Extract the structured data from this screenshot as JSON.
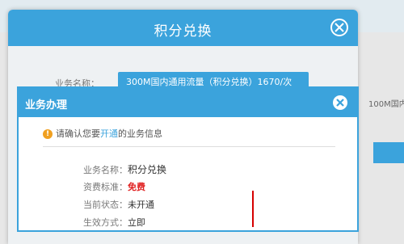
{
  "background": {
    "side_text": "100M国内"
  },
  "outer_dialog": {
    "title": "积分兑换",
    "field_label": "业务名称：",
    "field_value": "300M国内通用流量（积分兑换）1670/次"
  },
  "inner_dialog": {
    "title": "业务办理",
    "notice_prefix": "请确认您要",
    "notice_highlight": "开通",
    "notice_suffix": "的业务信息",
    "notice_icon": "!",
    "rows": [
      {
        "label": "业务名称：",
        "value": "积分兑换"
      },
      {
        "label": "资费标准：",
        "value": "免费"
      },
      {
        "label": "当前状态：",
        "value": "未开通"
      },
      {
        "label": "生效方式：",
        "value": "立即"
      }
    ]
  },
  "colors": {
    "accent": "#3ba3dc",
    "free_price": "#e02020",
    "annotation_arrow": "#d60000"
  }
}
